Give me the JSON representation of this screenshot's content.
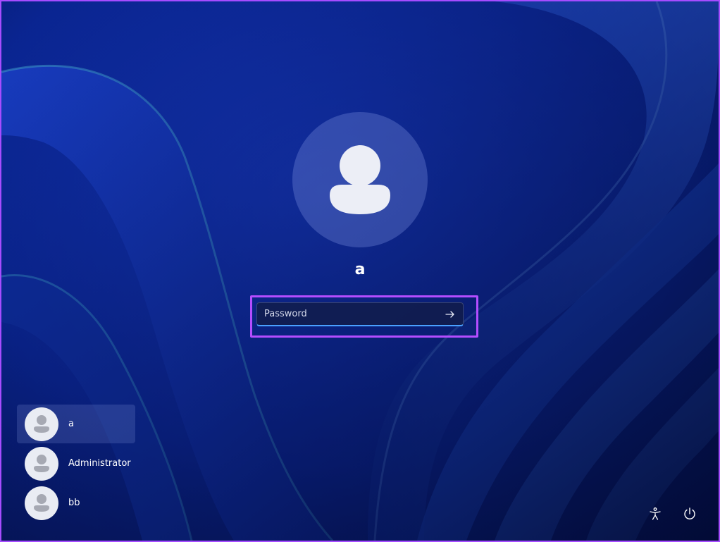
{
  "login": {
    "username": "a",
    "password_placeholder": "Password",
    "password_value": ""
  },
  "user_list": [
    {
      "name": "a",
      "selected": true
    },
    {
      "name": "Administrator",
      "selected": false
    },
    {
      "name": "bb",
      "selected": false
    }
  ],
  "icons": {
    "big_avatar": "person-icon",
    "submit": "arrow-right-icon",
    "accessibility": "accessibility-icon",
    "power": "power-icon"
  },
  "colors": {
    "highlight_border": "#b44dff",
    "field_focus_underline": "#4aa0ff",
    "wallpaper_base": "#0b2a9c"
  }
}
